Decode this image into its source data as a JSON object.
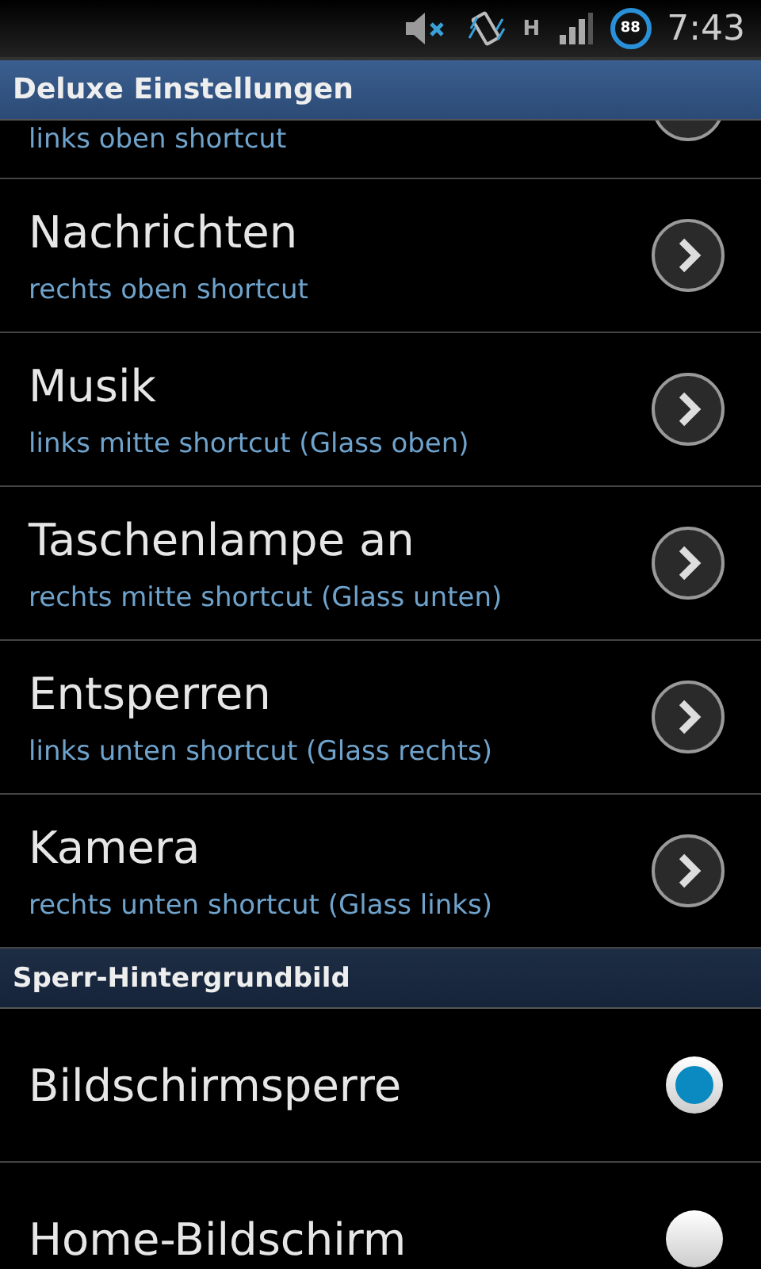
{
  "status_bar": {
    "network": "H",
    "battery": "88",
    "time": "7:43"
  },
  "sections": [
    {
      "title": "Deluxe Einstellungen",
      "items": [
        {
          "kind": "partial",
          "subtitle": "links oben shortcut"
        },
        {
          "kind": "link",
          "title": "Nachrichten",
          "subtitle": "rechts oben shortcut"
        },
        {
          "kind": "link",
          "title": "Musik",
          "subtitle": "links mitte shortcut (Glass oben)"
        },
        {
          "kind": "link",
          "title": "Taschenlampe an",
          "subtitle": "rechts mitte shortcut (Glass unten)"
        },
        {
          "kind": "link",
          "title": "Entsperren",
          "subtitle": "links unten shortcut (Glass rechts)"
        },
        {
          "kind": "link",
          "title": "Kamera",
          "subtitle": "rechts unten shortcut (Glass links)"
        }
      ]
    },
    {
      "title": "Sperr-Hintergrundbild",
      "items": [
        {
          "kind": "radio",
          "title": "Bildschirmsperre",
          "selected": true
        },
        {
          "kind": "radio",
          "title": "Home-Bildschirm",
          "selected": false
        }
      ]
    }
  ]
}
